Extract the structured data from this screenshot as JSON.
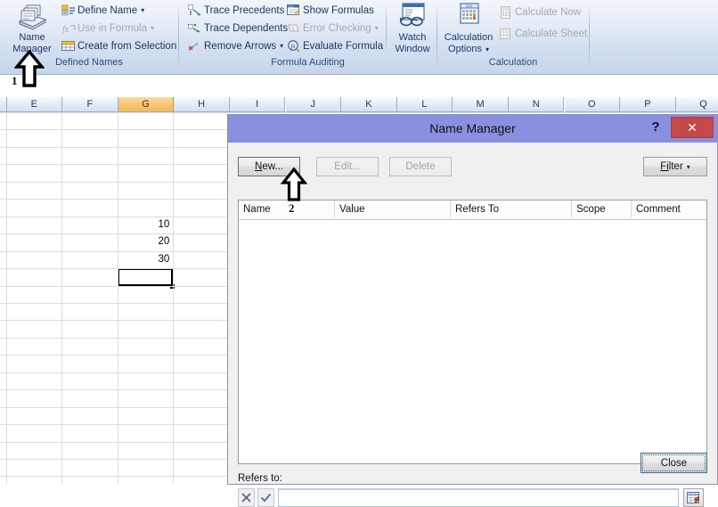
{
  "ribbon": {
    "groups": [
      {
        "label": "Defined Names"
      },
      {
        "label": "Formula Auditing"
      },
      {
        "label": "Calculation"
      }
    ],
    "defined_names": {
      "big_button": {
        "line1": "Name",
        "line2": "Manager",
        "icon": "name-manager-icon"
      },
      "commands": [
        {
          "label": "Define Name",
          "icon": "define-name-icon",
          "caret": "▾",
          "disabled": false
        },
        {
          "label": "Use in Formula",
          "icon": "use-in-formula-icon",
          "caret": "▾",
          "disabled": true
        },
        {
          "label": "Create from Selection",
          "icon": "create-from-selection-icon",
          "caret": "",
          "disabled": false
        }
      ]
    },
    "formula_auditing": {
      "commands": [
        {
          "label": "Trace Precedents",
          "icon": "trace-precedents-icon",
          "caret": "",
          "disabled": false
        },
        {
          "label": "Trace Dependents",
          "icon": "trace-dependents-icon",
          "caret": "",
          "disabled": false
        },
        {
          "label": "Remove Arrows",
          "icon": "remove-arrows-icon",
          "caret": "▾",
          "disabled": false
        },
        {
          "label": "Show Formulas",
          "icon": "show-formulas-icon",
          "caret": "",
          "disabled": false
        },
        {
          "label": "Error Checking",
          "icon": "error-checking-icon",
          "caret": "▾",
          "disabled": true
        },
        {
          "label": "Evaluate Formula",
          "icon": "evaluate-formula-icon",
          "caret": "",
          "disabled": false
        }
      ],
      "watch_window": {
        "line1": "Watch",
        "line2": "Window",
        "icon": "watch-window-icon"
      }
    },
    "calculation": {
      "big_button": {
        "line1": "Calculation",
        "line2": "Options",
        "caret": "▾",
        "icon": "calculation-options-icon"
      },
      "commands": [
        {
          "label": "Calculate Now",
          "icon": "calculate-now-icon",
          "disabled": true
        },
        {
          "label": "Calculate Sheet",
          "icon": "calculate-sheet-icon",
          "disabled": true
        }
      ]
    }
  },
  "sheet": {
    "columns": [
      "E",
      "F",
      "G",
      "H",
      "I",
      "J",
      "K",
      "L",
      "M",
      "N",
      "O",
      "P",
      "Q"
    ],
    "selected_column": "G",
    "cells": [
      {
        "column": "G",
        "row": 7,
        "value": "10"
      },
      {
        "column": "G",
        "row": 8,
        "value": "20"
      },
      {
        "column": "G",
        "row": 9,
        "value": "30"
      }
    ],
    "active_cell": {
      "column": "G",
      "row": 10,
      "value": ""
    }
  },
  "dialog": {
    "title": "Name Manager",
    "help_glyph": "?",
    "close_glyph": "✕",
    "toolbar": {
      "new_label": "New...",
      "new_label_pre": "N",
      "new_label_post": "ew...",
      "edit_label": "Edit...",
      "delete_label": "Delete",
      "filter_label_pre": "Fi",
      "filter_label_post": "lter",
      "filter_caret": "▾"
    },
    "list": {
      "headers": [
        "Name",
        "Value",
        "Refers To",
        "Scope",
        "Comment"
      ],
      "rows": []
    },
    "refers_to": {
      "label": "Refers to:",
      "value": "",
      "placeholder": "",
      "cancel_icon": "cancel-x-icon",
      "accept_icon": "accept-check-icon",
      "range_picker_icon": "range-picker-icon"
    },
    "close_button_label": "Close"
  },
  "annotations": [
    {
      "number": "1",
      "target": "name-manager-button"
    },
    {
      "number": "2",
      "target": "new-button"
    }
  ],
  "colors": {
    "dialog_title_bg": "#8b8fe0",
    "close_button_bg": "#c4494b",
    "selected_column_header": "#f5b856",
    "ribbon_label_text": "#2b4c7e"
  }
}
